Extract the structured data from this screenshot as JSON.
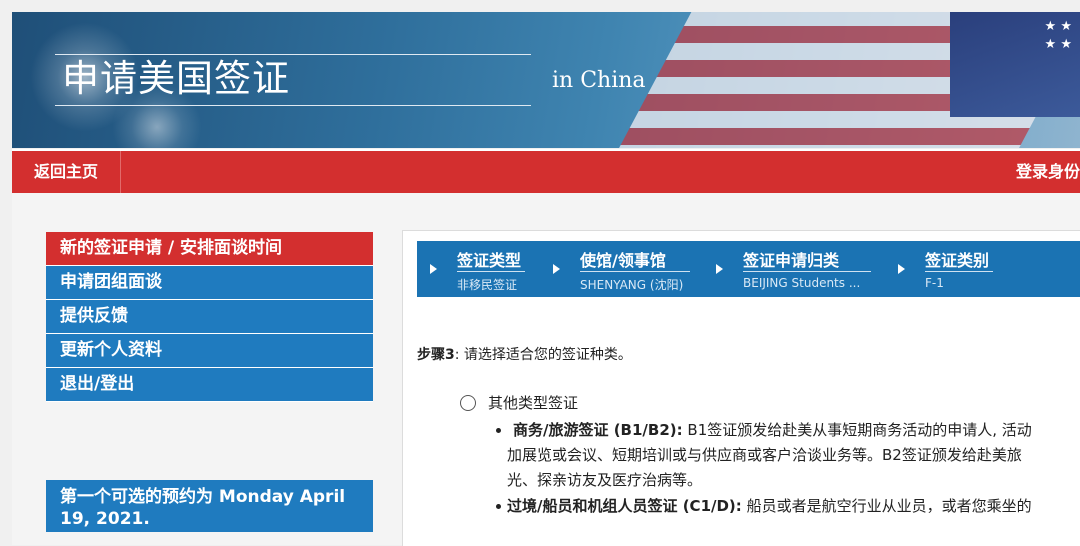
{
  "header": {
    "title": "申请美国签证",
    "subtitle": "in  China"
  },
  "topnav": {
    "home": "返回主页",
    "login": "登录身份"
  },
  "sidebar": {
    "items": [
      {
        "label": "新的签证申请 / 安排面谈时间",
        "active": true
      },
      {
        "label": "申请团组面谈",
        "active": false
      },
      {
        "label": "提供反馈",
        "active": false
      },
      {
        "label": "更新个人资料",
        "active": false
      },
      {
        "label": "退出/登出",
        "active": false
      }
    ],
    "appointment": "第一个可选的预约为 Monday April 19, 2021."
  },
  "progress": {
    "steps": [
      {
        "label": "签证类型",
        "value": "非移民签证"
      },
      {
        "label": "使馆/领事馆",
        "value": "SHENYANG (沈阳)"
      },
      {
        "label": "签证申请归类",
        "value": "BEIJING Students ..."
      },
      {
        "label": "签证类别",
        "value": "F-1"
      }
    ]
  },
  "main": {
    "step_prefix": "步骤3",
    "step_text": ": 请选择适合您的签证种类。",
    "option_label": "其他类型签证",
    "bullets": [
      {
        "bold": "商务/旅游签证 (B1/B2):",
        "line1": " B1签证颁发给赴美从事短期商务活动的申请人, 活动",
        "line2": "加展览或会议、短期培训或与供应商或客户洽谈业务等。B2签证颁发给赴美旅",
        "line3": "光、探亲访友及医疗治病等。"
      },
      {
        "bold": "过境/船员和机组人员签证 (C1/D):",
        "line1": " 船员或者是航空行业从业员，或者您乘坐的"
      }
    ]
  },
  "colors": {
    "red": "#d32f2f",
    "blue": "#1f7bbf",
    "step_blue": "#1b73b3"
  }
}
